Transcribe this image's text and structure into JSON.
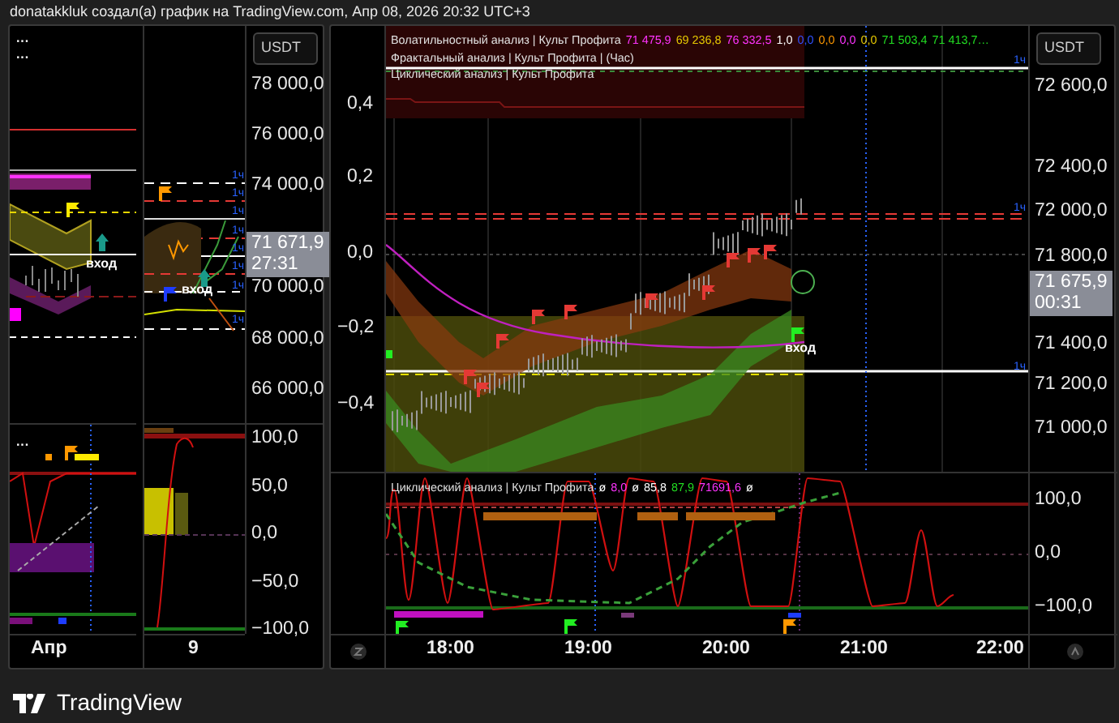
{
  "header": {
    "text": "donatakkluk создал(а) график на TradingView.com, Апр 08, 2026 20:32 UTC+3"
  },
  "left_chart": {
    "currency": "USDT",
    "legend_markers": [
      "···",
      "···"
    ],
    "price_axis": [
      "78 000,0",
      "76 000,0",
      "74 000,0",
      "70 000,0",
      "68 000,0",
      "66 000,0"
    ],
    "price_tag": {
      "price": "71 671,9",
      "countdown": "27:31"
    },
    "signal_labels": [
      "вход",
      "вход"
    ],
    "interval_tags": [
      "1ч",
      "1ч",
      "1ч",
      "1ч",
      "1ч",
      "1ч",
      "1ч",
      "1ч"
    ],
    "oscillator_legend_marker": "···",
    "oscillator_axis": [
      "100,0",
      "50,0",
      "0,0",
      "−50,0",
      "−100,0"
    ],
    "time_axis": [
      "Апр",
      "9"
    ]
  },
  "main_chart": {
    "currency": "USDT",
    "legend": [
      {
        "title": "Волатильностный анализ | Культ Профита",
        "values": [
          {
            "text": "71 475,9",
            "color": "#ff33ff"
          },
          {
            "text": "69 236,8",
            "color": "#e6c800"
          },
          {
            "text": "76 332,5",
            "color": "#ff33ff"
          },
          {
            "text": "1,0",
            "color": "#ffffff"
          },
          {
            "text": "0,0",
            "color": "#3050ff"
          },
          {
            "text": "0,0",
            "color": "#ff9800"
          },
          {
            "text": "0,0",
            "color": "#ff33ff"
          },
          {
            "text": "0,0",
            "color": "#e6c800"
          },
          {
            "text": "71 503,4",
            "color": "#22dd22"
          },
          {
            "text": "71 413,7…",
            "color": "#22dd22"
          }
        ]
      },
      {
        "title": "Фрактальный анализ | Культ Профита | (Час)"
      },
      {
        "title": "Циклический анализ | Культ Профита"
      }
    ],
    "left_axis": [
      "0,4",
      "0,2",
      "0,0",
      "−0,2",
      "−0,4"
    ],
    "price_axis": [
      "72 600,0",
      "72 400,0",
      "72 000,0",
      "71 800,0",
      "71 400,0",
      "71 200,0",
      "71 000,0"
    ],
    "price_tag": {
      "price": "71 675,9",
      "countdown": "00:31"
    },
    "signal_label": "вход",
    "interval_tags": [
      "1ч",
      "1ч",
      "1ч"
    ],
    "oscillator": {
      "legend": {
        "title": "Циклический анализ | Культ Профита",
        "values": [
          {
            "text": "ø",
            "color": "#ffffff"
          },
          {
            "text": "8,0",
            "color": "#ff33ff"
          },
          {
            "text": "ø",
            "color": "#ffffff"
          },
          {
            "text": "85,8",
            "color": "#ffffff"
          },
          {
            "text": "87,9",
            "color": "#22dd22"
          },
          {
            "text": "71691,6",
            "color": "#ff33ff"
          },
          {
            "text": "ø",
            "color": "#ffffff"
          }
        ]
      },
      "axis": [
        "100,0",
        "0,0",
        "−100,0"
      ]
    },
    "time_axis": [
      "18:00",
      "19:00",
      "20:00",
      "21:00",
      "22:00"
    ]
  },
  "footer": {
    "brand": "TradingView"
  }
}
